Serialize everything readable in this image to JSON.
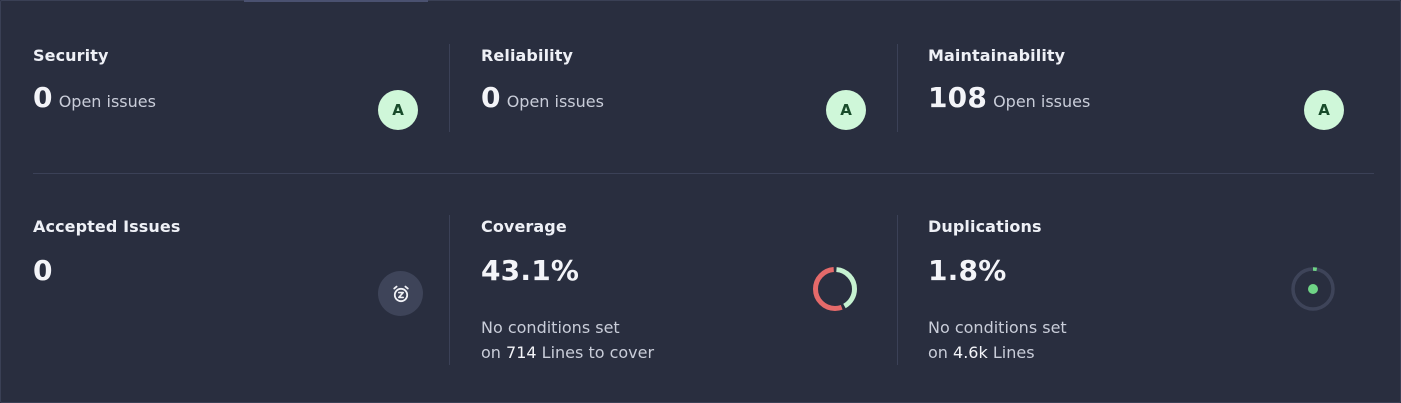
{
  "security": {
    "title": "Security",
    "value": "0",
    "unit": "Open issues",
    "rating": "A"
  },
  "reliability": {
    "title": "Reliability",
    "value": "0",
    "unit": "Open issues",
    "rating": "A"
  },
  "maintainability": {
    "title": "Maintainability",
    "value": "108",
    "unit": "Open issues",
    "rating": "A"
  },
  "accepted": {
    "title": "Accepted Issues",
    "value": "0",
    "icon": "alarm-snooze-icon"
  },
  "coverage": {
    "title": "Coverage",
    "value": "43.1%",
    "percent": 43.1,
    "conditions": "No conditions set",
    "on": "on",
    "lines": "714",
    "lines_label": "Lines to cover"
  },
  "duplications": {
    "title": "Duplications",
    "value": "1.8%",
    "percent": 1.8,
    "conditions": "No conditions set",
    "on": "on",
    "lines": "4.6k",
    "lines_label": "Lines"
  },
  "colors": {
    "rating_a_bg": "#cff7d9",
    "rating_a_text": "#184b2a",
    "coverage_uncovered": "#e56a6a",
    "coverage_covered": "#c6f2d1",
    "duplication_dot": "#6fd486"
  }
}
